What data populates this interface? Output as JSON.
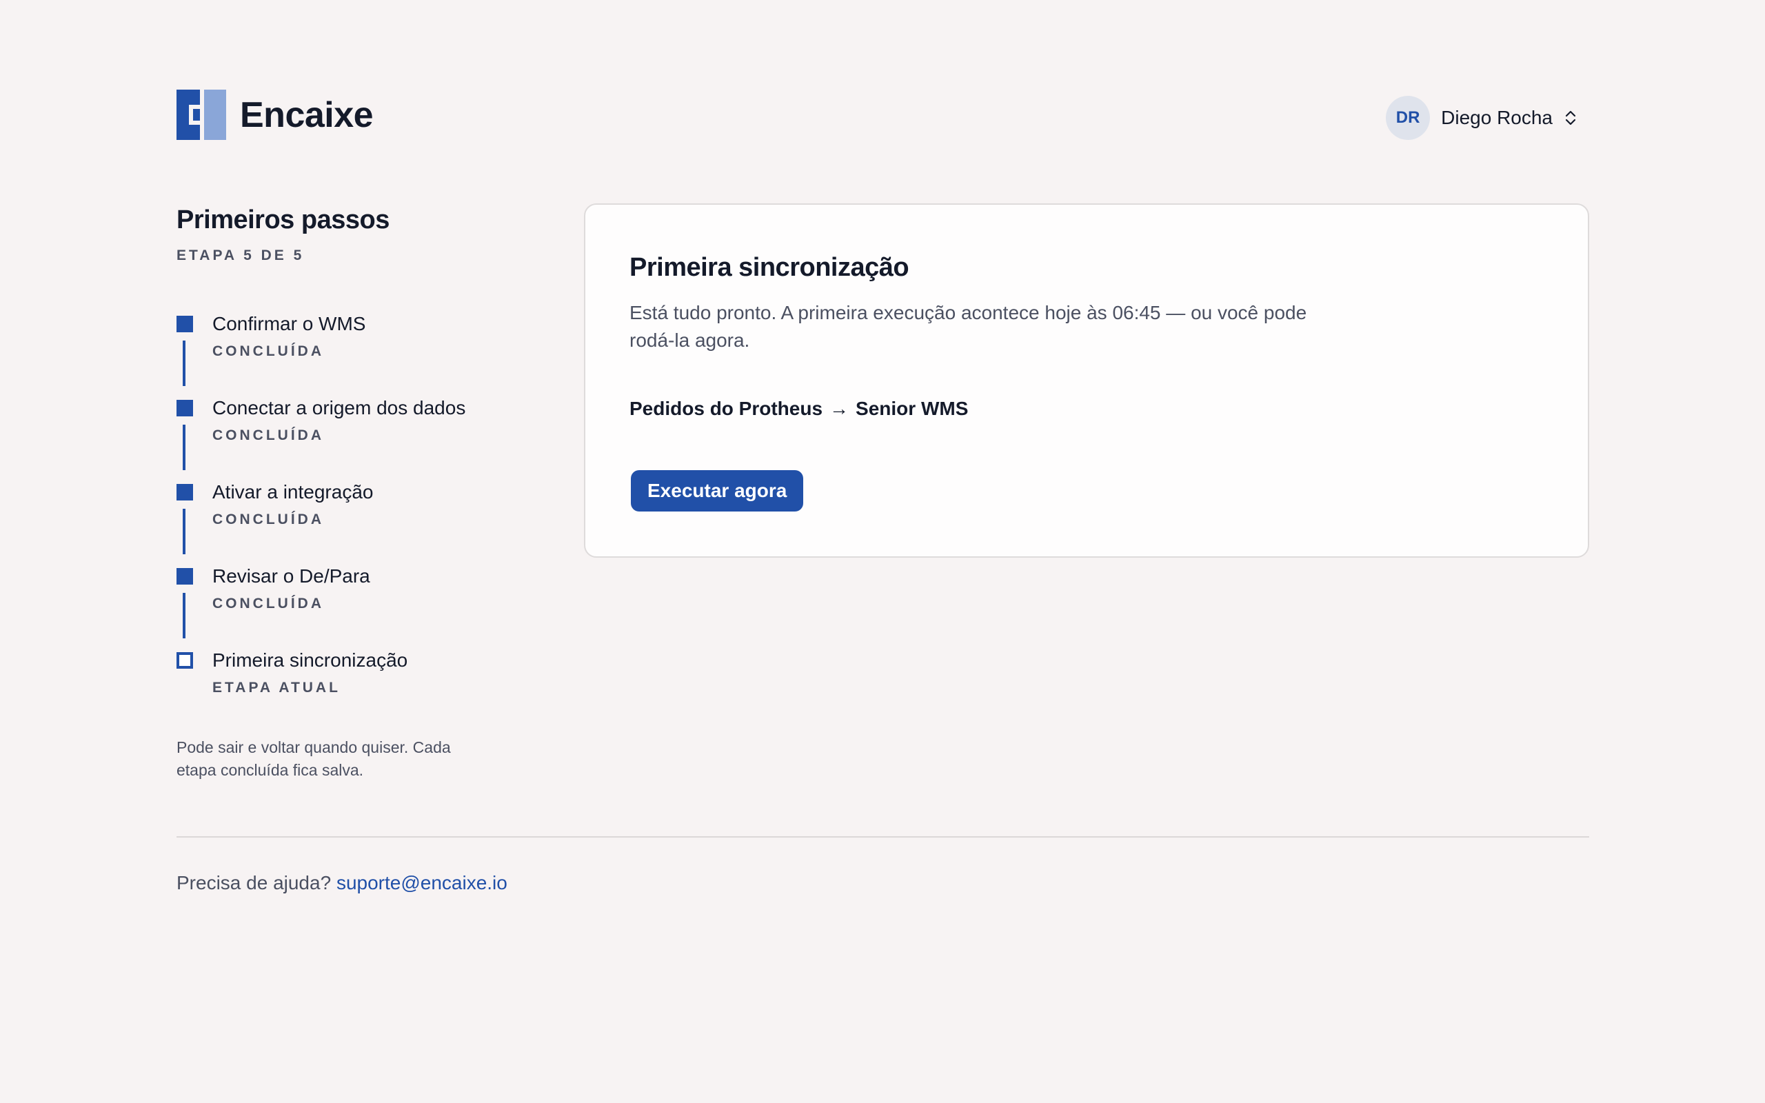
{
  "app": {
    "brand_name": "Encaixe",
    "accent_color": "#2150a8"
  },
  "user": {
    "initials": "DR",
    "name": "Diego Rocha",
    "menu_icon": "chevron-up-down-icon"
  },
  "sidebar": {
    "title": "Primeiros passos",
    "progress": "ETAPA 5 DE 5",
    "steps": [
      {
        "label": "Confirmar o WMS",
        "status": "CONCLUÍDA"
      },
      {
        "label": "Conectar a origem dos dados",
        "status": "CONCLUÍDA"
      },
      {
        "label": "Ativar a integração",
        "status": "CONCLUÍDA"
      },
      {
        "label": "Revisar o De/Para",
        "status": "CONCLUÍDA"
      },
      {
        "label": "Primeira sincronização",
        "status": "ETAPA ATUAL"
      }
    ],
    "note": "Pode sair e voltar quando quiser. Cada etapa concluída fica salva."
  },
  "main": {
    "title": "Primeira sincronização",
    "description": "Está tudo pronto. A primeira execução acontece hoje às 06:45 — ou você pode rodá-la agora.",
    "flow": {
      "source": "Pedidos do Protheus",
      "arrow": "→",
      "target": "Senior WMS"
    },
    "run_button": "Executar agora"
  },
  "footer": {
    "help_text": "Precisa de ajuda?",
    "help_email": "suporte@encaixe.io"
  }
}
